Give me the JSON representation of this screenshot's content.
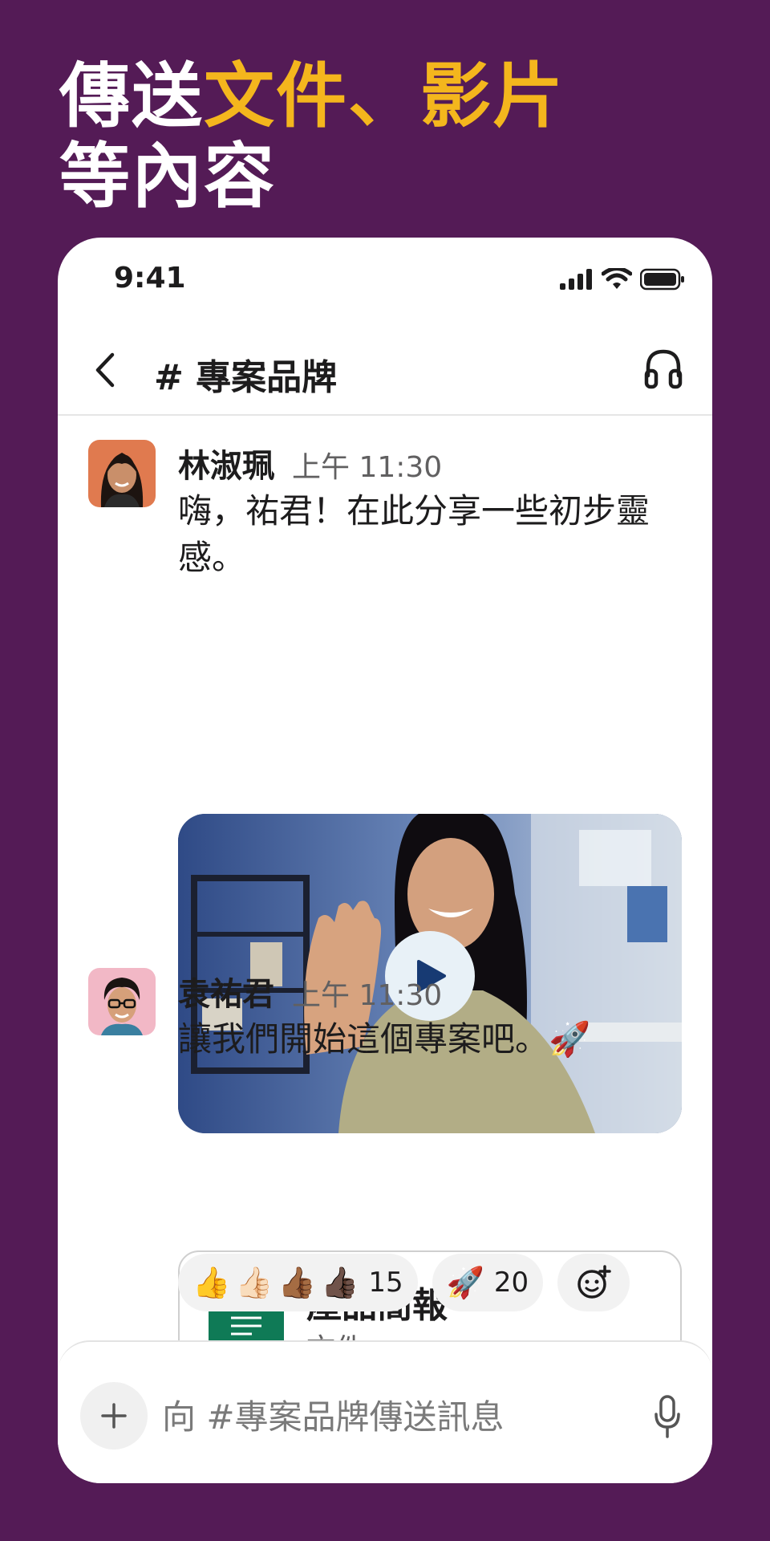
{
  "headline": {
    "part1": "傳送",
    "highlight": "文件、影片",
    "line2": "等內容"
  },
  "status_bar": {
    "time": "9:41"
  },
  "channel": {
    "title": "# 專案品牌"
  },
  "messages": [
    {
      "author": "林淑珮",
      "time": "上午 11:30",
      "text": "嗨，祐君！在此分享一些初步靈感。",
      "avatar": "woman-portrait",
      "attachment": {
        "type": "video",
        "icon": "play-icon"
      }
    },
    {
      "author": "袁祐君",
      "time": "上午 11:30",
      "text": "讓我們開始這個專案吧。🚀",
      "avatar": "man-with-glasses-portrait",
      "attachment": {
        "type": "file",
        "title": "產品簡報",
        "subtitle": "文件"
      }
    }
  ],
  "reactions": [
    {
      "emojis": [
        "👍",
        "👍🏻",
        "👍🏾",
        "👍🏿"
      ],
      "count": "15"
    },
    {
      "emojis": [
        "🚀"
      ],
      "count": "20"
    },
    {
      "emojis": [],
      "icon": "add-reaction-icon"
    }
  ],
  "composer": {
    "placeholder": "向 #專案品牌傳送訊息"
  },
  "colors": {
    "background": "#541b56",
    "highlight": "#f4b61d",
    "file_icon": "#0f7a56"
  }
}
